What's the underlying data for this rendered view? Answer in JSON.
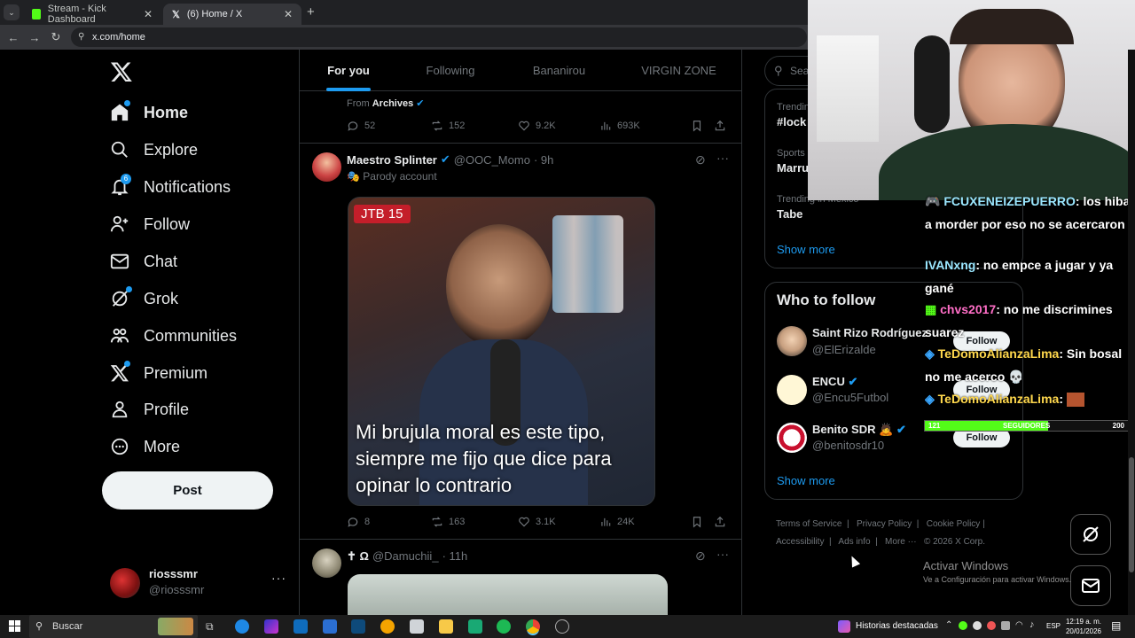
{
  "browser": {
    "tabs": [
      {
        "label": "Stream - Kick Dashboard"
      },
      {
        "label": "(6) Home / X"
      }
    ],
    "url": "x.com/home"
  },
  "nav": {
    "items": [
      {
        "label": "Home",
        "icon": "home-icon"
      },
      {
        "label": "Explore",
        "icon": "search-icon"
      },
      {
        "label": "Notifications",
        "icon": "bell-icon",
        "badge": "6"
      },
      {
        "label": "Follow",
        "icon": "person-add-icon"
      },
      {
        "label": "Chat",
        "icon": "mail-icon"
      },
      {
        "label": "Grok",
        "icon": "grok-icon"
      },
      {
        "label": "Communities",
        "icon": "communities-icon"
      },
      {
        "label": "Premium",
        "icon": "x-logo-icon"
      },
      {
        "label": "Profile",
        "icon": "person-icon"
      },
      {
        "label": "More",
        "icon": "more-circle-icon"
      }
    ],
    "post_label": "Post",
    "account": {
      "name": "riosssmr",
      "handle": "@riosssmr"
    }
  },
  "timeline": {
    "tabs": [
      "For you",
      "Following",
      "Bananirou",
      "VIRGIN ZONE"
    ],
    "first_post": {
      "from_label": "From",
      "from_name": "Archives",
      "replies": "52",
      "reposts": "152",
      "likes": "9.2K",
      "views": "693K"
    },
    "second_post": {
      "name": "Maestro Splinter",
      "handle": "@OOC_Momo",
      "time": "· 9h",
      "label": "Parody account",
      "video_tag": "JTB  15",
      "caption": "Mi brujula moral es este tipo, siempre me fijo que dice para opinar lo contrario",
      "replies": "8",
      "reposts": "163",
      "likes": "3.1K",
      "views": "24K"
    },
    "third_post": {
      "name": "✝ Ω",
      "handle": "@Damuchii_",
      "time": "· 11h"
    }
  },
  "sidebar": {
    "search_placeholder": "Sea",
    "trends": [
      {
        "meta": "Trendin",
        "name": "#lock"
      },
      {
        "meta": "Sports",
        "name": "Marru"
      },
      {
        "meta": "Trending in Mexico",
        "name": "Tabe"
      }
    ],
    "show_more": "Show more",
    "who_to_follow_title": "Who to follow",
    "suggestions": [
      {
        "name": "Saint Rizo Rodríguez",
        "handle": "@ElErizalde",
        "button": "Follow"
      },
      {
        "name": "ENCU",
        "handle": "@Encu5Futbol",
        "button": "Follow"
      },
      {
        "name": "Benito SDR",
        "handle": "@benitosdr10",
        "button": "Follow"
      }
    ],
    "show_more_2": "Show more",
    "footer_links": [
      "Terms of Service",
      "Privacy Policy",
      "Cookie Policy",
      "Accessibility",
      "Ads info",
      "More ···",
      "© 2026 X Corp."
    ]
  },
  "chat_overlay": {
    "messages": [
      {
        "user": "FCUXENEIZEPUERRO",
        "text": ": los hiba a morder por eso no se acercaron",
        "color": "#9be7ff"
      },
      {
        "user": "IVANxng",
        "text": ": no empce a jugar y ya gané",
        "color": "#9be7ff"
      },
      {
        "user": "chvs2017",
        "text": ": no me discrimines suarez",
        "color": "#ff6ec7"
      },
      {
        "user": "TeDomoAlianzaLima",
        "text": ": Sin bosal no me acerco 💀",
        "color": "#ffd84d"
      },
      {
        "user": "TeDomoAlianzaLima",
        "text": ":",
        "color": "#ffd84d"
      }
    ],
    "followers_bar": {
      "current": "121",
      "label": "SEGUIDORES",
      "goal": "200",
      "progress": 0.605
    }
  },
  "windows_watermark": {
    "title": "Activar Windows",
    "subtitle": "Ve a Configuración para activar Windows."
  },
  "taskbar": {
    "search_label": "Buscar",
    "news_label": "Historias destacadas",
    "lang": "ESP",
    "time": "12:19 a. m.",
    "date": "20/01/2026"
  }
}
